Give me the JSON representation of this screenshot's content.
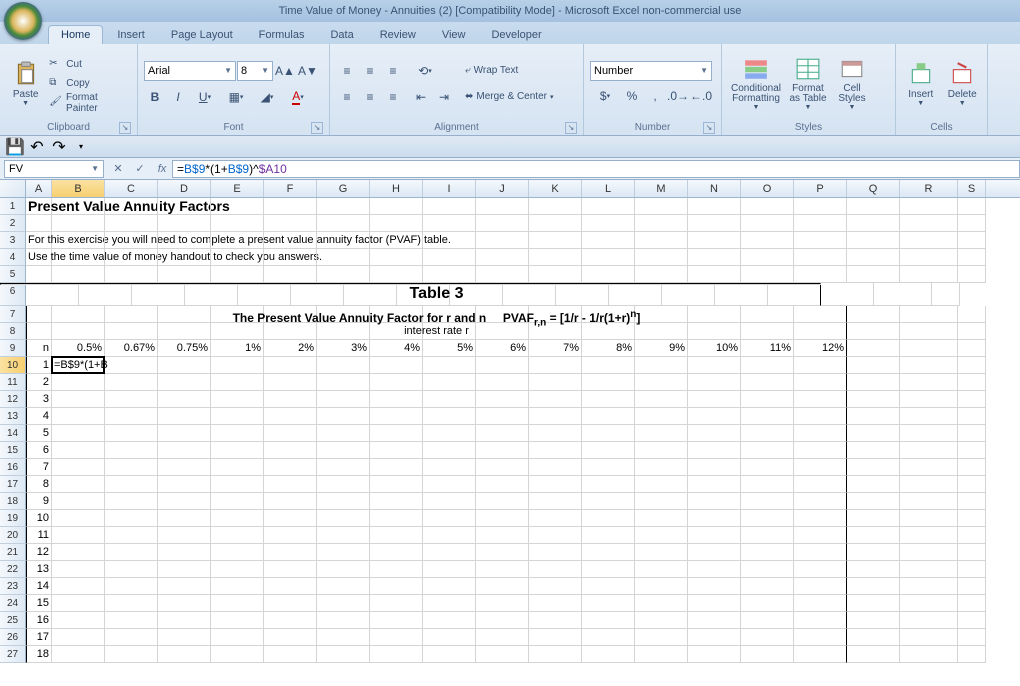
{
  "title": "Time Value of Money - Annuities (2)  [Compatibility Mode] - Microsoft Excel non-commercial use",
  "tabs": [
    "Home",
    "Insert",
    "Page Layout",
    "Formulas",
    "Data",
    "Review",
    "View",
    "Developer"
  ],
  "active_tab": 0,
  "clipboard": {
    "paste": "Paste",
    "cut": "Cut",
    "copy": "Copy",
    "format_painter": "Format Painter",
    "label": "Clipboard"
  },
  "font": {
    "name": "Arial",
    "size": "8",
    "label": "Font"
  },
  "alignment": {
    "wrap": "Wrap Text",
    "merge": "Merge & Center",
    "label": "Alignment"
  },
  "number": {
    "format": "Number",
    "label": "Number"
  },
  "styles": {
    "conditional": "Conditional Formatting",
    "format_table": "Format as Table",
    "cell_styles": "Cell Styles",
    "label": "Styles"
  },
  "cells": {
    "insert": "Insert",
    "delete": "Delete",
    "label": "Cells"
  },
  "namebox": "FV",
  "formula": "=B$9*(1+B$9)^$A10",
  "formula_parts": {
    "p1": "=",
    "r1": "B$9",
    "p2": "*(1+",
    "r2": "B$9",
    "p3": ")^",
    "r3": "$A10"
  },
  "columns": [
    "A",
    "B",
    "C",
    "D",
    "E",
    "F",
    "G",
    "H",
    "I",
    "J",
    "K",
    "L",
    "M",
    "N",
    "O",
    "P",
    "Q",
    "R",
    "S"
  ],
  "row_numbers": [
    1,
    2,
    3,
    4,
    5,
    6,
    7,
    8,
    9,
    10,
    11,
    12,
    13,
    14,
    15,
    16,
    17,
    18,
    19,
    20,
    21,
    22,
    23,
    24,
    25,
    26,
    27
  ],
  "sheet": {
    "A1": "Present Value Annuity Factors",
    "A3": "For this exercise you will need to complete a present value annuity factor (PVAF) table.",
    "A4": "Use the time value of money handout to check you answers.",
    "table_title": "Table 3",
    "subtitle_left": "The Present Value Annuity Factor for r and n",
    "subtitle_right_pre": "PVAF",
    "subtitle_right_sub": "r,n",
    "subtitle_right_post": " = [1/r - 1/r(1+r)",
    "subtitle_right_sup": "n",
    "subtitle_right_end": "]",
    "interest_label": "interest rate r",
    "A9": "n",
    "rates": [
      "0.5%",
      "0.67%",
      "0.75%",
      "1%",
      "2%",
      "3%",
      "4%",
      "5%",
      "6%",
      "7%",
      "8%",
      "9%",
      "10%",
      "11%",
      "12%"
    ],
    "n_values": [
      1,
      2,
      3,
      4,
      5,
      6,
      7,
      8,
      9,
      10,
      11,
      12,
      13,
      14,
      15,
      16,
      17,
      18
    ],
    "B10_edit": "=B$9*(1+B"
  },
  "active_cell": "B10",
  "chart_data": {
    "type": "table",
    "title": "Table 3 — The Present Value Annuity Factor for r and n  PVAF_{r,n} = [1/r - 1/r(1+r)^n]",
    "xlabel": "interest rate r",
    "ylabel": "n",
    "categories": [
      "0.5%",
      "0.67%",
      "0.75%",
      "1%",
      "2%",
      "3%",
      "4%",
      "5%",
      "6%",
      "7%",
      "8%",
      "9%",
      "10%",
      "11%",
      "12%"
    ],
    "rows": [
      1,
      2,
      3,
      4,
      5,
      6,
      7,
      8,
      9,
      10,
      11,
      12,
      13,
      14,
      15,
      16,
      17,
      18
    ],
    "values": []
  }
}
